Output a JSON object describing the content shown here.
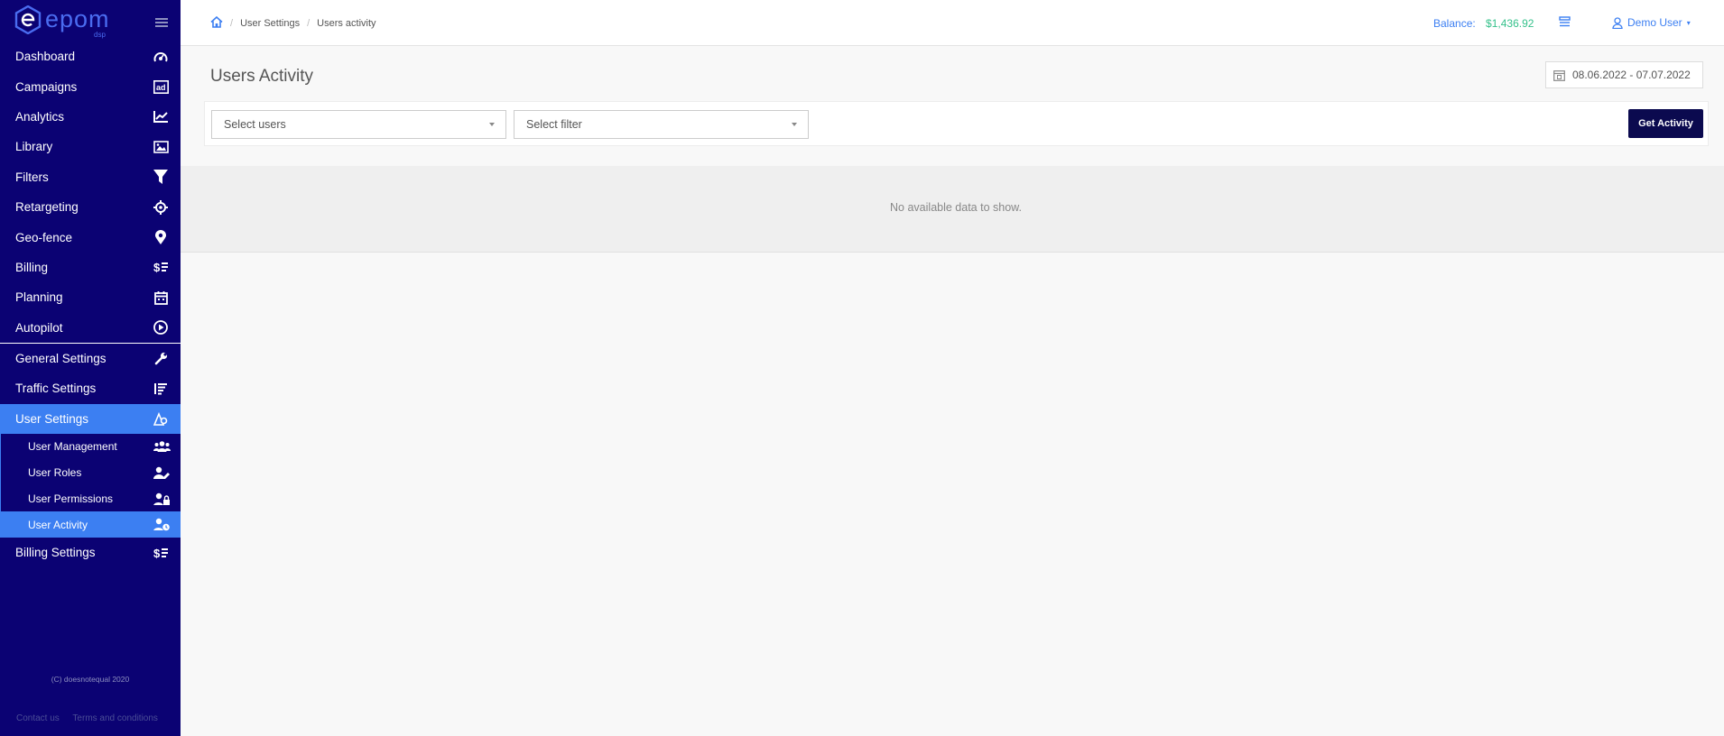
{
  "brand": {
    "name": "epom",
    "sub": "dsp",
    "accent": "#4a6cf0"
  },
  "sidebar": {
    "items": [
      {
        "label": "Dashboard",
        "icon": "speedometer-icon"
      },
      {
        "label": "Campaigns",
        "icon": "ad-icon"
      },
      {
        "label": "Analytics",
        "icon": "chart-line-icon"
      },
      {
        "label": "Library",
        "icon": "image-icon"
      },
      {
        "label": "Filters",
        "icon": "funnel-icon"
      },
      {
        "label": "Retargeting",
        "icon": "crosshair-icon"
      },
      {
        "label": "Geo-fence",
        "icon": "map-pin-icon"
      },
      {
        "label": "Billing",
        "icon": "dollar-list-icon"
      },
      {
        "label": "Planning",
        "icon": "calendar-icon"
      },
      {
        "label": "Autopilot",
        "icon": "play-circle-icon"
      }
    ],
    "settings": [
      {
        "label": "General Settings",
        "icon": "wrench-icon"
      },
      {
        "label": "Traffic Settings",
        "icon": "bars-icon"
      },
      {
        "label": "User Settings",
        "icon": "user-cog-icon"
      }
    ],
    "user_sub": [
      {
        "label": "User Management",
        "icon": "users-icon"
      },
      {
        "label": "User Roles",
        "icon": "user-edit-icon"
      },
      {
        "label": "User Permissions",
        "icon": "user-lock-icon"
      },
      {
        "label": "User Activity",
        "icon": "user-clock-icon"
      }
    ],
    "billing_settings": {
      "label": "Billing Settings",
      "icon": "dollar-list-icon"
    },
    "copyright": "(C) doesnotequal 2020",
    "footer": {
      "contact": "Contact us",
      "terms": "Terms and conditions"
    },
    "colors": {
      "bg": "#0b0273",
      "active": "#3c7ff2"
    }
  },
  "header": {
    "breadcrumb": {
      "home_icon": "home-icon",
      "level1": "User Settings",
      "level2": "Users activity"
    },
    "balance_label": "Balance:",
    "balance_value": "$1,436.92",
    "user_name": "Demo User"
  },
  "main": {
    "title": "Users Activity",
    "date_range": "08.06.2022 - 07.07.2022",
    "select_users_placeholder": "Select users",
    "select_filter_placeholder": "Select filter",
    "get_activity_label": "Get Activity",
    "empty_message": "No available data to show."
  }
}
